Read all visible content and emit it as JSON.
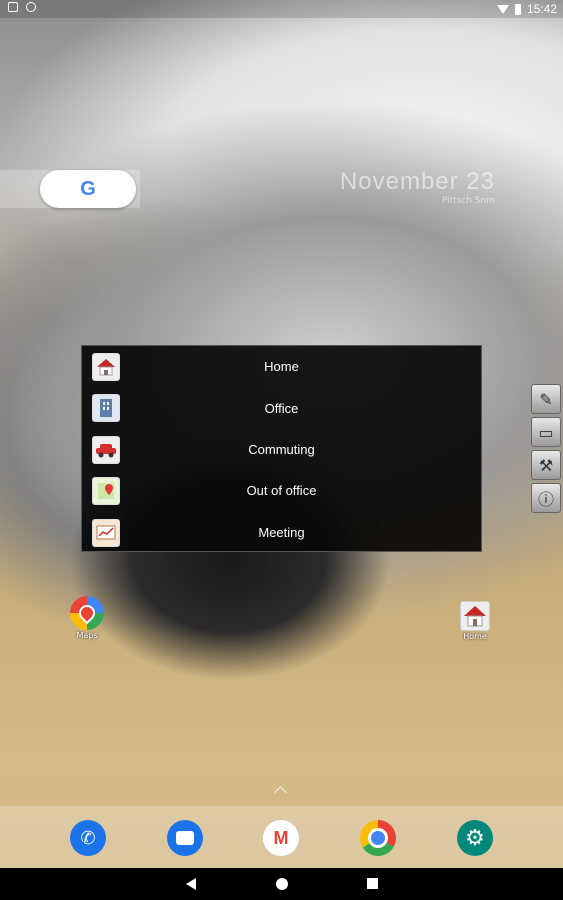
{
  "status_bar": {
    "time": "15:42",
    "icons": [
      "screenshot-icon",
      "notification-icon",
      "wifi-icon",
      "battery-icon"
    ]
  },
  "search": {
    "logo": "G"
  },
  "date_widget": {
    "date": "November 23",
    "subtext": "Pittsch Snm"
  },
  "popup_menu": {
    "items": [
      {
        "label": "Home",
        "icon": "house-icon"
      },
      {
        "label": "Office",
        "icon": "office-building-icon"
      },
      {
        "label": "Commuting",
        "icon": "car-icon"
      },
      {
        "label": "Out of office",
        "icon": "map-pin-icon"
      },
      {
        "label": "Meeting",
        "icon": "meeting-chart-icon"
      }
    ]
  },
  "side_tools": {
    "items": [
      "pencil-icon",
      "note-icon",
      "wrench-icon",
      "info-icon"
    ]
  },
  "shortcuts": {
    "maps_label": "Maps",
    "home_label": "Home"
  },
  "dock": {
    "apps": [
      "phone-icon",
      "messages-icon",
      "gmail-icon",
      "chrome-icon",
      "settings-icon"
    ]
  },
  "colors": {
    "popup_bg": "#080808",
    "google_blue": "#4285F4",
    "settings_teal": "#00897b"
  }
}
